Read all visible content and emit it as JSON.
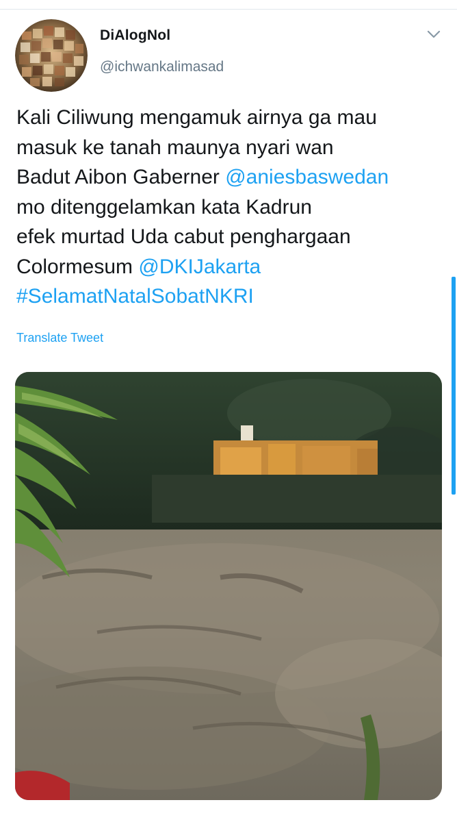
{
  "tweet": {
    "author_name": "DiAlogNol",
    "author_handle": "@ichwankalimasad",
    "text_lines": [
      [
        {
          "t": "Kali Ciliwung mengamuk airnya ga mau",
          "k": "text"
        }
      ],
      [
        {
          "t": "masuk ke tanah maunya nyari wan",
          "k": "text"
        }
      ],
      [
        {
          "t": "Badut Aibon Gaberner ",
          "k": "text"
        },
        {
          "t": "@aniesbaswedan",
          "k": "mention"
        }
      ],
      [
        {
          "t": "mo ditenggelamkan kata Kadrun",
          "k": "text"
        }
      ],
      [
        {
          "t": "efek murtad Uda cabut penghargaan",
          "k": "text"
        }
      ],
      [
        {
          "t": "Colormesum ",
          "k": "text"
        },
        {
          "t": "@DKIJakarta",
          "k": "mention"
        }
      ],
      [
        {
          "t": "#SelamatNatalSobatNKRI",
          "k": "hashtag"
        }
      ]
    ],
    "translate_label": "Translate Tweet",
    "menu_icon": "chevron-down-icon"
  },
  "colors": {
    "link": "#1da1f2",
    "secondary_text": "#657786",
    "primary_text": "#14171a"
  }
}
